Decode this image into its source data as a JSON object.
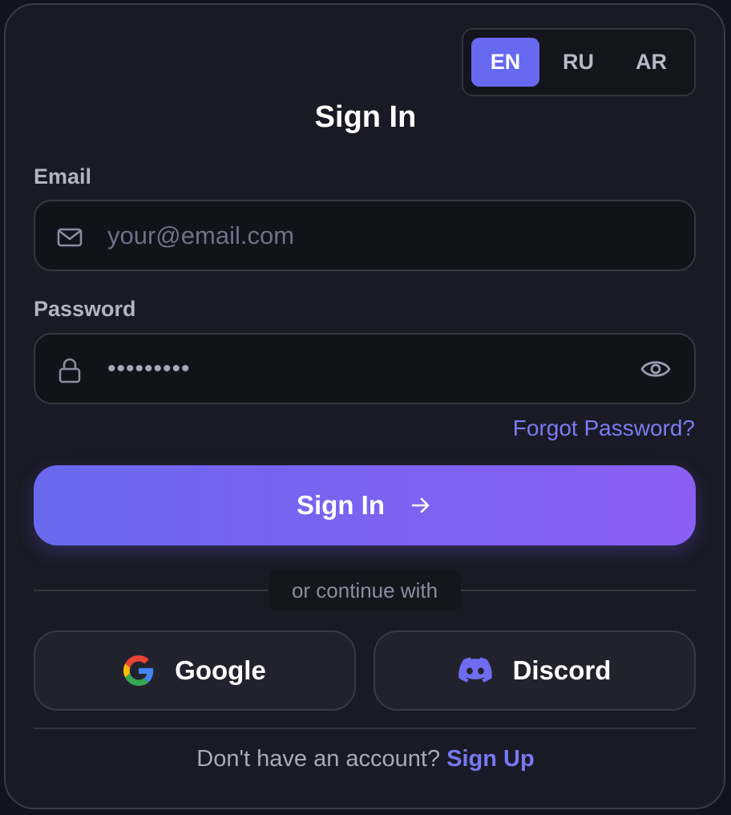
{
  "languages": {
    "active": "EN",
    "options": [
      "EN",
      "RU",
      "AR"
    ]
  },
  "title": "Sign In",
  "email": {
    "label": "Email",
    "placeholder": "your@email.com",
    "icon": "mail-icon"
  },
  "password": {
    "label": "Password",
    "value": "•••••••••",
    "icon": "lock-icon",
    "toggle_icon": "eye-icon"
  },
  "forgot_password": "Forgot Password?",
  "submit": {
    "label": "Sign In",
    "icon": "arrow-right-icon"
  },
  "divider_text": "or continue with",
  "social": {
    "google": "Google",
    "discord": "Discord"
  },
  "footer": {
    "prompt": "Don't have an account?",
    "link": "Sign Up"
  },
  "colors": {
    "accent": "#6769f0",
    "gradient_end": "#8a5ff2",
    "link": "#7a7cf0",
    "background": "#1a1a26"
  }
}
